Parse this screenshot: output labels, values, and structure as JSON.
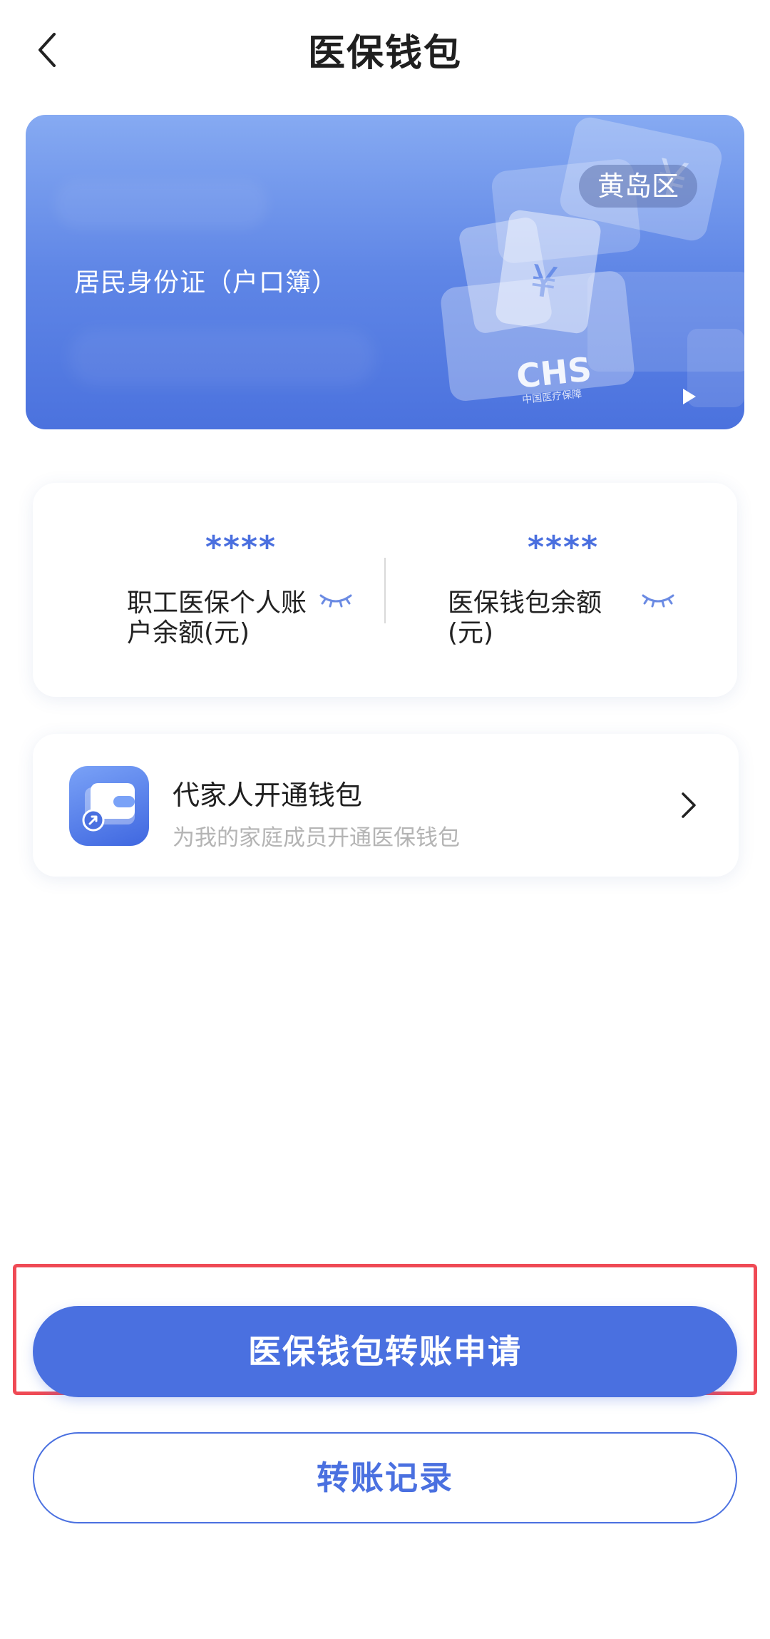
{
  "header": {
    "title": "医保钱包",
    "back_icon": "chevron-left-icon"
  },
  "banner": {
    "id_type_label": "居民身份证（户口簿）",
    "region_badge": "黄岛区",
    "colors": {
      "gradient_top": "#86aaf2",
      "gradient_bottom": "#4b72de"
    }
  },
  "balances": {
    "employee_account": {
      "value": "****",
      "label": "职工医保个人账户余额(元)"
    },
    "wallet": {
      "value": "****",
      "label": "医保钱包余额(元)"
    },
    "visibility_icon": "eye-closed-icon"
  },
  "family": {
    "title": "代家人开通钱包",
    "subtitle": "为我的家庭成员开通医保钱包",
    "icon": "wallet-icon"
  },
  "actions": {
    "transfer_apply": "医保钱包转账申请",
    "transfer_records": "转账记录"
  },
  "colors": {
    "accent": "#4a70e0",
    "highlight_border": "#ef4a55"
  }
}
